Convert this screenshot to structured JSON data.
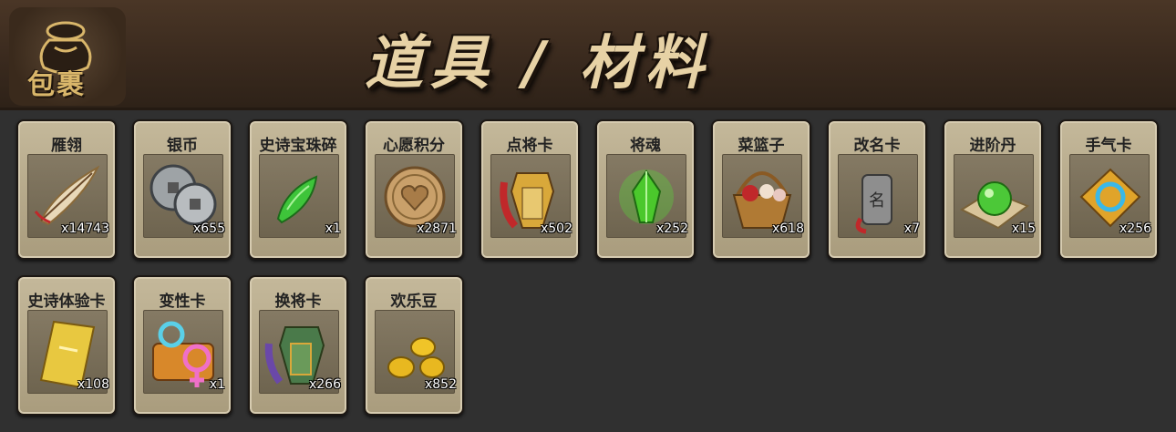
{
  "header": {
    "bag_label": "包裹",
    "title": "道具 / 材料"
  },
  "items": [
    {
      "name": "雁翎",
      "count": "x14743",
      "icon": "feather-icon"
    },
    {
      "name": "银币",
      "count": "x655",
      "icon": "silver-coin-icon"
    },
    {
      "name": "史诗宝珠碎",
      "count": "x1",
      "icon": "epic-orb-shard-icon"
    },
    {
      "name": "心愿积分",
      "count": "x2871",
      "icon": "wish-point-coin-icon"
    },
    {
      "name": "点将卡",
      "count": "x502",
      "icon": "general-token-icon"
    },
    {
      "name": "将魂",
      "count": "x252",
      "icon": "soul-crystal-icon"
    },
    {
      "name": "菜篮子",
      "count": "x618",
      "icon": "basket-icon"
    },
    {
      "name": "改名卡",
      "count": "x7",
      "icon": "rename-card-icon"
    },
    {
      "name": "进阶丹",
      "count": "x15",
      "icon": "advance-pill-icon"
    },
    {
      "name": "手气卡",
      "count": "x256",
      "icon": "luck-card-icon"
    },
    {
      "name": "史诗体验卡",
      "count": "x108",
      "icon": "epic-trial-card-icon"
    },
    {
      "name": "变性卡",
      "count": "x1",
      "icon": "gender-card-icon"
    },
    {
      "name": "换将卡",
      "count": "x266",
      "icon": "swap-general-card-icon"
    },
    {
      "name": "欢乐豆",
      "count": "x852",
      "icon": "gold-beans-icon"
    }
  ]
}
